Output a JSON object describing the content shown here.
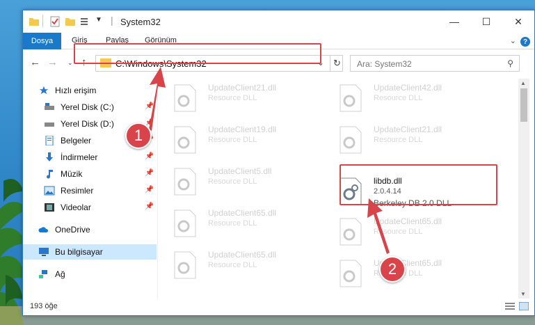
{
  "window": {
    "title": "System32",
    "qat_separator": "|"
  },
  "ribbon": {
    "file_tab": "Dosya",
    "tabs": [
      "Giriş",
      "Paylaş",
      "Görünüm"
    ]
  },
  "address_bar": {
    "path": "C:\\Windows\\System32"
  },
  "search": {
    "placeholder": "Ara: System32"
  },
  "sidebar": {
    "quick_access": "Hızlı erişim",
    "items": [
      {
        "label": "Yerel Disk (C:)",
        "icon": "drive-icon",
        "pinned": true
      },
      {
        "label": "Yerel Disk (D:)",
        "icon": "drive-icon",
        "pinned": true
      },
      {
        "label": "Belgeler",
        "icon": "documents-icon",
        "pinned": true
      },
      {
        "label": "İndirmeler",
        "icon": "download-icon",
        "pinned": true
      },
      {
        "label": "Müzik",
        "icon": "music-icon",
        "pinned": true
      },
      {
        "label": "Resimler",
        "icon": "pictures-icon",
        "pinned": true
      },
      {
        "label": "Videolar",
        "icon": "videos-icon",
        "pinned": true
      }
    ],
    "onedrive": "OneDrive",
    "this_pc": "Bu bilgisayar",
    "network": "Ağ"
  },
  "files": [
    {
      "name": "UpdateClient21.dll",
      "desc": "Resource DLL"
    },
    {
      "name": "UpdateClient42.dll",
      "desc": "Resource DLL"
    },
    {
      "name": "UpdateClient19.dll",
      "desc": "Resource DLL"
    },
    {
      "name": "UpdateClient21.dll",
      "desc": "Resource DLL"
    },
    {
      "name": "UpdateClient5.dll",
      "desc": "Resource DLL"
    },
    {
      "name": "UpdateClient65.dll",
      "desc": "Resource DLL"
    },
    {
      "name": "UpdateClient65.dll",
      "desc": "Resource DLL"
    },
    {
      "name": "UpdateClient65.dll",
      "desc": "Resource DLL"
    },
    {
      "name": "UpdateClient65.dll",
      "desc": "Resource DLL"
    }
  ],
  "selected_file": {
    "name": "libdb.dll",
    "version": "2.0.4.14",
    "description": "Berkeley DB 2.0 DLL"
  },
  "status": {
    "item_count": "193 öğe"
  },
  "annotations": {
    "badge1": "1",
    "badge2": "2",
    "color": "#d9434a"
  }
}
